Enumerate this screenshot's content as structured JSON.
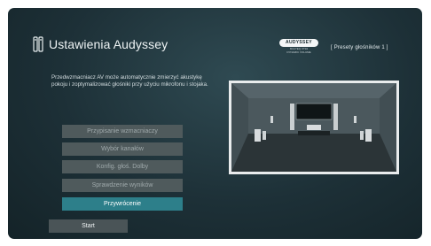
{
  "header": {
    "icon": "speaker-settings-icon",
    "title": "Ustawienia Audyssey"
  },
  "logo": {
    "brand": "AUDYSSEY",
    "sub1": "MULTEQ XT32",
    "sub2": "DYNAMIC VOLUME"
  },
  "preset": {
    "label": "[ Presety głośników 1 ]"
  },
  "description": "Przedwzmacniacz AV może automatycznie zmierzyć akustykę pokoju i zoptymalizować głośniki przy użyciu mikrofonu i stojaka.",
  "menu": {
    "items": [
      {
        "label": "Przypisanie wzmacniaczy",
        "active": false
      },
      {
        "label": "Wybór kanałów",
        "active": false
      },
      {
        "label": "Konfig. głoś. Dolby",
        "active": false
      },
      {
        "label": "Sprawdzenie wyników",
        "active": false
      },
      {
        "label": "Przywrócenie",
        "active": true
      }
    ]
  },
  "start": {
    "label": "Start"
  },
  "colors": {
    "accent": "#2d7f8a",
    "menu_bg": "#4f5a5c",
    "background": "#1d3037"
  }
}
